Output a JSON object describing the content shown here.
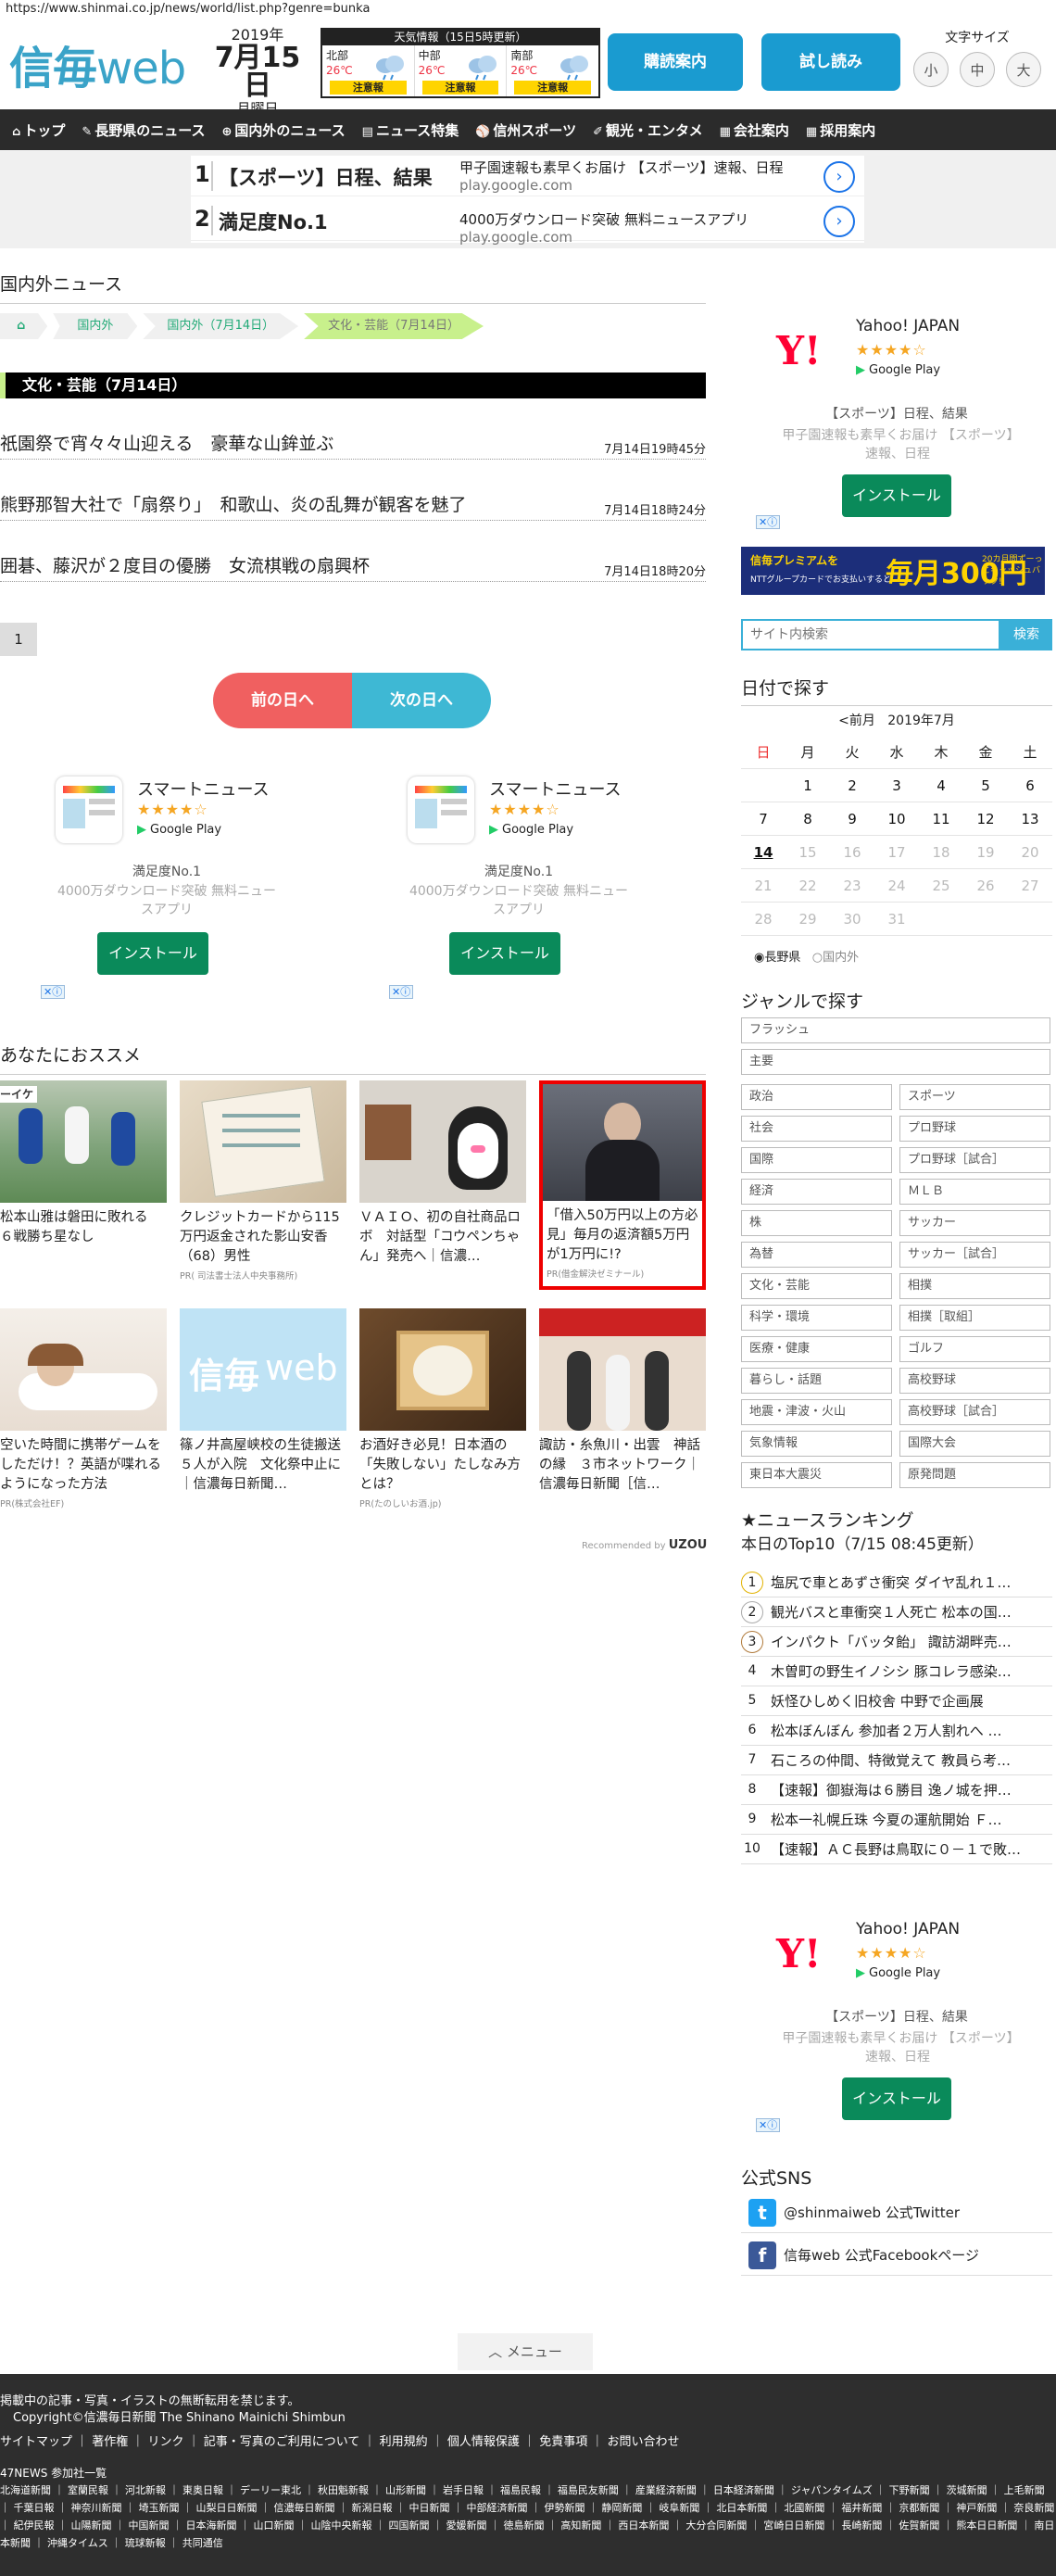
{
  "browser": {
    "url": "https://www.shinmai.co.jp/news/world/list.php?genre=bunka"
  },
  "header": {
    "logo_main": "信毎",
    "logo_sub": "web",
    "year": "2019年",
    "monthday": "7月15日",
    "weekday": "月曜日",
    "weather": {
      "title": "天気情報（15日5時更新）",
      "regions": [
        {
          "name": "北部",
          "temp": "26℃",
          "warn": "注意報"
        },
        {
          "name": "中部",
          "temp": "26℃",
          "warn": "注意報"
        },
        {
          "name": "南部",
          "temp": "26℃",
          "warn": "注意報"
        }
      ]
    },
    "btn_kiosk": "購読案内",
    "btn_trial": "試し読み",
    "fontsize": {
      "label": "文字サイズ",
      "small": "小",
      "medium": "中",
      "large": "大"
    }
  },
  "nav": [
    {
      "icon": "⌂",
      "label": "トップ"
    },
    {
      "icon": "✎",
      "label": "長野県のニュース"
    },
    {
      "icon": "⊕",
      "label": "国内外のニュース"
    },
    {
      "icon": "▤",
      "label": "ニュース特集"
    },
    {
      "icon": "⚾",
      "label": "信州スポーツ"
    },
    {
      "icon": "✐",
      "label": "観光・エンタメ"
    },
    {
      "icon": "▦",
      "label": "会社案内"
    },
    {
      "icon": "▦",
      "label": "採用案内"
    }
  ],
  "topad": [
    {
      "num": "1",
      "title": "【スポーツ】日程、結果",
      "desc": "甲子園速報も素早くお届け 【スポーツ】速報、日程",
      "url": "play.google.com"
    },
    {
      "num": "2",
      "title": "満足度No.1",
      "desc": "4000万ダウンロード突破 無料ニュースアプリ",
      "url": "play.google.com"
    }
  ],
  "section": {
    "title": "国内外ニュース",
    "crumbs": [
      "",
      "国内外",
      "国内外（7月14日）",
      "文化・芸能（7月14日）"
    ],
    "category": "文化・芸能（7月14日）"
  },
  "articles": [
    {
      "title": "祇園祭で宵々々山迎える　豪華な山鉾並ぶ",
      "date": "7月14日19時45分"
    },
    {
      "title": "熊野那智大社で「扇祭り」　和歌山、炎の乱舞が観客を魅了",
      "date": "7月14日18時24分"
    },
    {
      "title": "囲碁、藤沢が２度目の優勝　女流棋戦の扇興杯",
      "date": "7月14日18時20分"
    }
  ],
  "pager": {
    "page": "1",
    "prev": "前の日へ",
    "next": "次の日へ"
  },
  "appads": [
    {
      "name": "スマートニュース",
      "stars": "★★★★☆",
      "store": "Google Play",
      "tagline": "満足度No.1",
      "desc": "4000万ダウンロード突破 無料ニュースアプリ",
      "install": "インストール"
    },
    {
      "name": "スマートニュース",
      "stars": "★★★★☆",
      "store": "Google Play",
      "tagline": "満足度No.1",
      "desc": "4000万ダウンロード突破 無料ニュースアプリ",
      "install": "インストール"
    }
  ],
  "reco": {
    "title": "あなたにおススメ",
    "by_label": "Recommended by",
    "by_brand": "UZOU",
    "items": [
      {
        "text": "松本山雅は磐田に敗れる　６戦勝ち星なし",
        "pr": ""
      },
      {
        "text": "クレジットカードから115万円返金された影山安香（68）男性",
        "pr": "PR( 司法書士法人中央事務所)"
      },
      {
        "text": "ＶＡＩＯ、初の自社商品ロボ　対話型「コウペンちゃん」発売へ｜信濃…",
        "pr": ""
      },
      {
        "text": "「借入50万円以上の方必見」毎月の返済額5万円が1万円に!?",
        "pr": "PR(借金解決ゼミナール)"
      },
      {
        "text": "空いた時間に携帯ゲームをしただけ！？英語が喋れるようになった方法",
        "pr": "PR(株式会社EF)"
      },
      {
        "text": "篠ノ井高屋峡校の生徒搬送　５人が入院　文化祭中止に｜信濃毎日新聞…",
        "pr": ""
      },
      {
        "text": "お酒好き必見！日本酒の「失敗しない」たしなみ方とは？",
        "pr": "PR(たのしいお酒.jp)"
      },
      {
        "text": "諏訪・糸魚川・出雲　神話の縁　３市ネットワーク｜信濃毎日新聞［信…",
        "pr": ""
      }
    ]
  },
  "sidebar": {
    "yahoo": {
      "name": "Yahoo! JAPAN",
      "logo": "Y!",
      "stars": "★★★★☆",
      "store": "Google Play",
      "tagline": "【スポーツ】日程、結果",
      "desc": "甲子園速報も素早くお届け 【スポーツ】速報、日程",
      "install": "インストール"
    },
    "premium": {
      "a": "信毎プレミアムを",
      "b": "NTTグループカードでお支払いすると",
      "c": "毎月300円",
      "d": "20カ月間ずーっとキャッシュバック!!"
    },
    "search": {
      "placeholder": "サイト内検索",
      "button": "検索"
    },
    "calendar": {
      "title": "日付で探す",
      "prev": "<前月",
      "month": "2019年7月",
      "weekdays": [
        "日",
        "月",
        "火",
        "水",
        "木",
        "金",
        "土"
      ],
      "weeks": [
        [
          "",
          "1",
          "2",
          "3",
          "4",
          "5",
          "6"
        ],
        [
          "7",
          "8",
          "9",
          "10",
          "11",
          "12",
          "13"
        ],
        [
          "14",
          "15",
          "16",
          "17",
          "18",
          "19",
          "20"
        ],
        [
          "21",
          "22",
          "23",
          "24",
          "25",
          "26",
          "27"
        ],
        [
          "28",
          "29",
          "30",
          "31",
          "",
          "",
          ""
        ]
      ],
      "radio1": "長野県",
      "radio2": "国内外"
    },
    "genre": {
      "title": "ジャンルで探す",
      "wide": [
        "フラッシュ",
        "主要"
      ],
      "pairs": [
        [
          "政治",
          "スポーツ"
        ],
        [
          "社会",
          "プロ野球"
        ],
        [
          "国際",
          "プロ野球［試合］"
        ],
        [
          "経済",
          "ＭＬＢ"
        ],
        [
          "株",
          "サッカー"
        ],
        [
          "為替",
          "サッカー［試合］"
        ],
        [
          "文化・芸能",
          "相撲"
        ],
        [
          "科学・環境",
          "相撲［取組］"
        ],
        [
          "医療・健康",
          "ゴルフ"
        ],
        [
          "暮らし・話題",
          "高校野球"
        ],
        [
          "地震・津波・火山",
          "高校野球［試合］"
        ],
        [
          "気象情報",
          "国際大会"
        ],
        [
          "東日本大震災",
          "原発問題"
        ]
      ]
    },
    "ranking": {
      "title": "ニュースランキング",
      "subtitle": "本日のTop10（7/15 08:45更新）",
      "items": [
        "塩尻で車とあずさ衝突 ダイヤ乱れ１…",
        "観光バスと車衝突１人死亡 松本の国…",
        "インパクト「バッタ飴」 諏訪湖畔売…",
        "木曽町の野生イノシシ 豚コレラ感染…",
        "妖怪ひしめく旧校舎 中野で企画展",
        "松本ぼんぼん 参加者２万人割れへ …",
        "石ころの仲間、特徴覚えて 教員ら考…",
        "【速報】御嶽海は６勝目 逸ノ城を押…",
        "松本一礼幌丘珠 今夏の運航開始 Ｆ…",
        "【速報】ＡＣ長野は鳥取に０－１で敗…"
      ]
    },
    "sns": {
      "title": "公式SNS",
      "twitter": "@shinmaiweb 公式Twitter",
      "facebook": "信毎web 公式Facebookページ"
    }
  },
  "menu_label": "メニュー",
  "footer": {
    "notice": "掲載中の記事・写真・イラストの無断転用を禁じます。",
    "copyright": "Copyright©信濃毎日新聞 The Shinano Mainichi Shimbun",
    "links": "サイトマップ ｜ 著作権 ｜ リンク ｜ 記事・写真のご利用について ｜ 利用規約 ｜ 個人情報保護 ｜ 免責事項 ｜ お問い合わせ",
    "network_title": "47NEWS 参加社一覧",
    "network": "北海道新聞 ｜ 室蘭民報 ｜ 河北新報 ｜ 東奥日報 ｜ デーリー東北 ｜ 秋田魁新報 ｜ 山形新聞 ｜ 岩手日報 ｜ 福島民報 ｜ 福島民友新聞 ｜ 産業経済新聞 ｜ 日本経済新聞 ｜ ジャパンタイムズ ｜ 下野新聞 ｜ 茨城新聞 ｜ 上毛新聞 ｜ 千葉日報 ｜ 神奈川新聞 ｜ 埼玉新聞 ｜ 山梨日日新聞 ｜ 信濃毎日新聞 ｜ 新潟日報 ｜ 中日新聞 ｜ 中部経済新聞 ｜ 伊勢新聞 ｜ 静岡新聞 ｜ 岐阜新聞 ｜ 北日本新聞 ｜ 北國新聞 ｜ 福井新聞 ｜ 京都新聞 ｜ 神戸新聞 ｜ 奈良新聞 ｜ 紀伊民報 ｜ 山陽新聞 ｜ 中国新聞 ｜ 日本海新聞 ｜ 山口新聞 ｜ 山陰中央新報 ｜ 四国新聞 ｜ 愛媛新聞 ｜ 徳島新聞 ｜ 高知新聞 ｜ 西日本新聞 ｜ 大分合同新聞 ｜ 宮崎日日新聞 ｜ 長崎新聞 ｜ 佐賀新聞 ｜ 熊本日日新聞 ｜ 南日本新聞 ｜ 沖縄タイムス ｜ 琉球新報 ｜ 共同通信"
  }
}
